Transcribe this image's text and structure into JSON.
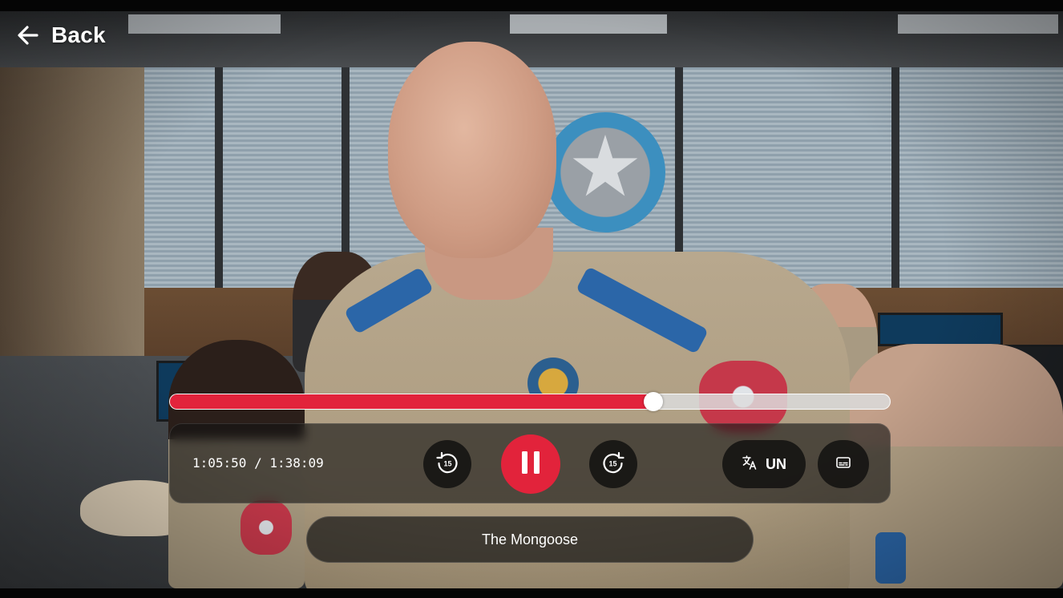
{
  "navigation": {
    "back_label": "Back",
    "back_icon": "arrow-left-icon"
  },
  "playback": {
    "current_time": "1:05:50",
    "separator": " / ",
    "total_time": "1:38:09",
    "progress_fraction": 0.671,
    "state": "playing"
  },
  "controls": {
    "rewind_icon": "rewind-15-icon",
    "rewind_seconds": "15",
    "pause_icon": "pause-icon",
    "forward_icon": "forward-15-icon",
    "forward_seconds": "15",
    "language_icon": "translate-icon",
    "language_label": "UN",
    "subtitles_icon": "closed-captions-icon"
  },
  "episode": {
    "title": "The Mongoose"
  },
  "colors": {
    "accent": "#e2233b",
    "track": "#dcdcdc",
    "control_bg": "rgba(20,20,20,0.62)",
    "text": "#ffffff"
  }
}
